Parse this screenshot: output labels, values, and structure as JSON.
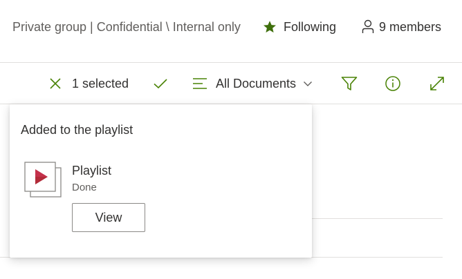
{
  "header": {
    "group_info": "Private group | Confidential \\ Internal only",
    "following_label": "Following",
    "members_label": "9 members"
  },
  "commandbar": {
    "selected_label": "1 selected",
    "view_label": "All Documents"
  },
  "popup": {
    "title": "Added to the playlist",
    "item_name": "Playlist",
    "item_status": "Done",
    "view_button": "View"
  },
  "icons": {
    "following": "star-icon",
    "members": "person-icon",
    "clear_selection": "close-icon",
    "confirm": "checkmark-icon",
    "view_switcher": "list-lines-icon",
    "dropdown": "chevron-down-icon",
    "filter": "filter-icon",
    "info": "info-icon",
    "expand": "expand-icon",
    "playlist": "playlist-icon"
  },
  "colors": {
    "accent_green": "#498205",
    "star_green": "#3f6f0c",
    "playlist_red": "#c4314b",
    "text_primary": "#323130",
    "text_secondary": "#605e5c",
    "divider": "#e1dfdd"
  }
}
